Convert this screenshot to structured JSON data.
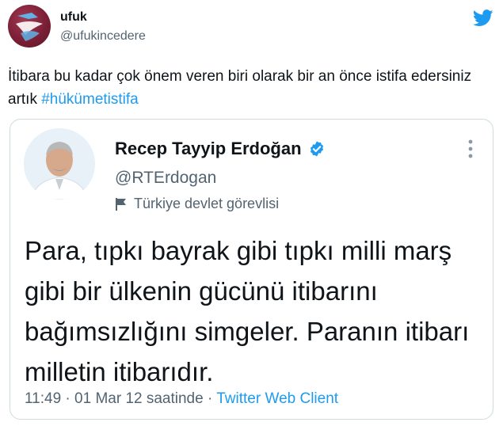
{
  "outer_tweet": {
    "name": "ufuk",
    "handle": "@ufukincedere",
    "text_before": "İtibara bu kadar çok önem veren biri olarak bir an önce istifa edersiniz artık ",
    "hashtag": "#hükümetistifa"
  },
  "quoted_tweet": {
    "name": "Recep Tayyip Erdoğan",
    "handle": "@RTErdogan",
    "label": "Türkiye devlet görevlisi",
    "text": "Para, tıpkı bayrak gibi tıpkı milli marş gibi bir ülkenin gücünü itibarını bağımsızlığını simgeler. Paranın itibarı milletin itibarıdır.",
    "time": "11:49",
    "separator": "·",
    "date": "01 Mar 12 saatinde",
    "client": "Twitter Web Client"
  },
  "icons": {
    "brand": "twitter-bird-icon",
    "verified": "verified-badge-icon",
    "label": "flag-icon",
    "more": "more-vertical-icon"
  },
  "colors": {
    "accent": "#1d9bf0",
    "secondary_text": "#536471",
    "border": "#cfd9de",
    "avatar_outer": "#7b1f36"
  }
}
